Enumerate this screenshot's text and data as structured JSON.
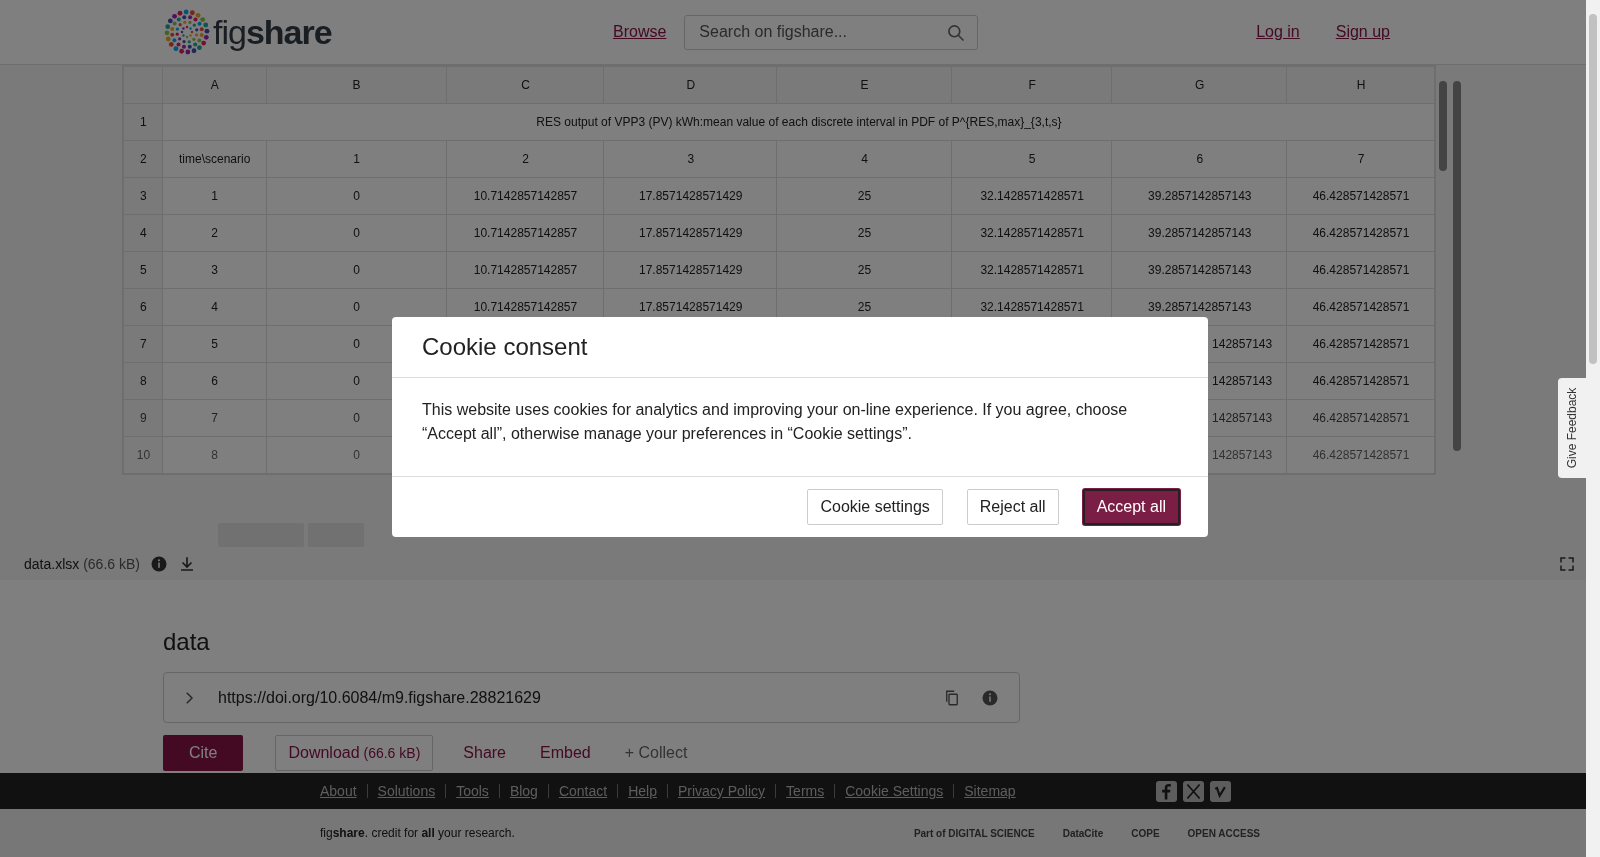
{
  "header": {
    "logo": "fig**share**",
    "nav_link": "Browse",
    "search": {
      "placeholder": "Search on figshare..."
    },
    "auth_links": [
      "Log in",
      "Sign up"
    ]
  },
  "spreadsheet": {
    "column_letters": [
      "A",
      "B",
      "C",
      "D",
      "E",
      "F",
      "G",
      "H"
    ],
    "title_row": {
      "number": "1",
      "text": "RES output of VPP3 (PV) kWh:mean value of each discrete interval in PDF of P^{RES,max}_{3,t,s}"
    },
    "rows": [
      {
        "number": "2",
        "cells": [
          "time\\scenario",
          "1",
          "2",
          "3",
          "4",
          "5",
          "6",
          "7"
        ]
      },
      {
        "number": "3",
        "cells": [
          "1",
          "0",
          "10.7142857142857",
          "17.8571428571429",
          "25",
          "32.1428571428571",
          "39.2857142857143",
          "46.428571428571"
        ]
      },
      {
        "number": "4",
        "cells": [
          "2",
          "0",
          "10.7142857142857",
          "17.8571428571429",
          "25",
          "32.1428571428571",
          "39.2857142857143",
          "46.428571428571"
        ]
      },
      {
        "number": "5",
        "cells": [
          "3",
          "0",
          "10.7142857142857",
          "17.8571428571429",
          "25",
          "32.1428571428571",
          "39.2857142857143",
          "46.428571428571"
        ]
      },
      {
        "number": "6",
        "cells": [
          "4",
          "0",
          "10.7142857142857",
          "17.8571428571429",
          "25",
          "32.1428571428571",
          "39.2857142857143",
          "46.428571428571"
        ]
      },
      {
        "number": "7",
        "covered": true,
        "cells": [
          "5",
          "0",
          null,
          null,
          null,
          null,
          "142857143",
          "46.428571428571"
        ]
      },
      {
        "number": "8",
        "covered": true,
        "cells": [
          "6",
          "0",
          null,
          null,
          null,
          null,
          "142857143",
          "46.428571428571"
        ]
      },
      {
        "number": "9",
        "covered": true,
        "cells": [
          "7",
          "0",
          null,
          null,
          null,
          null,
          "142857143",
          "46.428571428571"
        ]
      },
      {
        "number": "10",
        "covered": true,
        "cells": [
          "8",
          "0",
          null,
          null,
          null,
          null,
          "142857143",
          "46.428571428571"
        ]
      }
    ]
  },
  "file_bar": {
    "name": "data.xlsx",
    "size": "(66.6 kB)"
  },
  "item": {
    "title": "data",
    "doi": "https://doi.org/10.6084/m9.figshare.28821629",
    "actions": [
      {
        "kind": "primary",
        "label": "Cite"
      },
      {
        "kind": "outline",
        "label": "Download",
        "extra": "(66.6 kB)"
      },
      {
        "kind": "link",
        "label": "Share"
      },
      {
        "kind": "link",
        "label": "Embed"
      },
      {
        "kind": "muted",
        "label": "+ Collect"
      }
    ]
  },
  "footer": {
    "links": [
      "About",
      "Solutions",
      "Tools",
      "Blog",
      "Contact",
      "Help",
      "Privacy Policy",
      "Terms",
      "Cookie Settings",
      "Sitemap"
    ],
    "tagline": "fig**share**. credit for **all** your research.",
    "partner_logos": [
      "Part of DIGITAL SCIENCE",
      "DataCite",
      "COPE",
      "OPEN ACCESS"
    ]
  },
  "feedback_tab": "Give Feedback",
  "cookie_dialog": {
    "title": "Cookie consent",
    "body": "This website uses cookies for analytics and improving your on-line experience. If you agree, choose “Accept all”, otherwise manage your preferences in “Cookie settings”.",
    "buttons": [
      {
        "label": "Cookie settings",
        "primary": false
      },
      {
        "label": "Reject all",
        "primary": false
      },
      {
        "label": "Accept all",
        "primary": true
      }
    ]
  }
}
